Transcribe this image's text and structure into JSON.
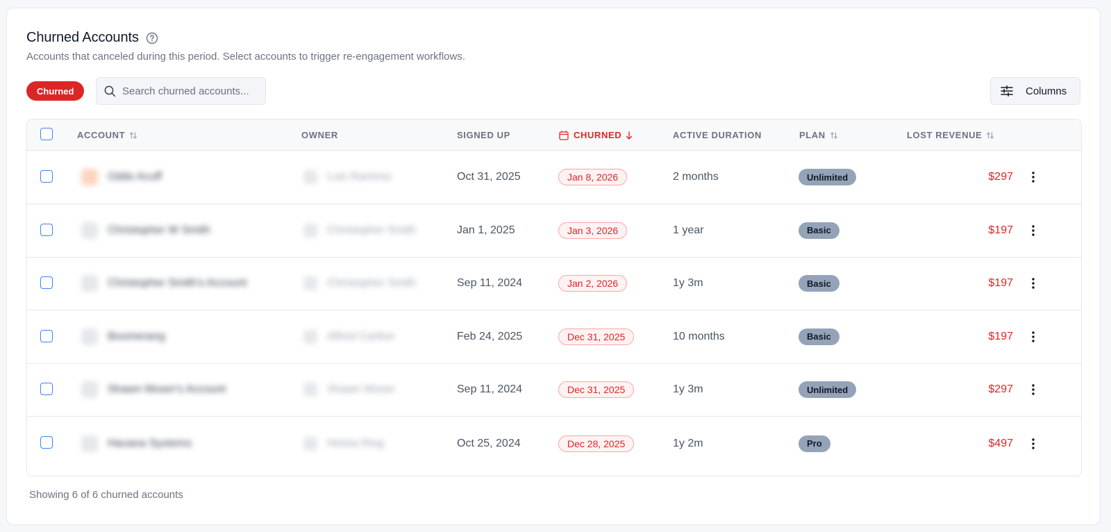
{
  "header": {
    "title": "Churned Accounts",
    "subtitle": "Accounts that canceled during this period. Select accounts to trigger re-engagement workflows."
  },
  "toolbar": {
    "filter_chip": "Churned",
    "search_placeholder": "Search churned accounts...",
    "columns_label": "Columns"
  },
  "table": {
    "columns": [
      "ACCOUNT",
      "OWNER",
      "SIGNED UP",
      "CHURNED",
      "ACTIVE DURATION",
      "PLAN",
      "LOST REVENUE"
    ],
    "rows": [
      {
        "account": "Odds Acuff",
        "owner": "Luis Ramirez",
        "signed_up": "Oct 31, 2025",
        "churned": "Jan 8, 2026",
        "duration": "2 months",
        "plan": "Unlimited",
        "revenue": "$297"
      },
      {
        "account": "Christopher W Smith",
        "owner": "Christopher Smith",
        "signed_up": "Jan 1, 2025",
        "churned": "Jan 3, 2026",
        "duration": "1 year",
        "plan": "Basic",
        "revenue": "$197"
      },
      {
        "account": "Christopher Smith's Account",
        "owner": "Christopher Smith",
        "signed_up": "Sep 11, 2024",
        "churned": "Jan 2, 2026",
        "duration": "1y 3m",
        "plan": "Basic",
        "revenue": "$197"
      },
      {
        "account": "Boomerang",
        "owner": "Alfred Carlton",
        "signed_up": "Feb 24, 2025",
        "churned": "Dec 31, 2025",
        "duration": "10 months",
        "plan": "Basic",
        "revenue": "$197"
      },
      {
        "account": "Shawn Moser's Account",
        "owner": "Shawn Moser",
        "signed_up": "Sep 11, 2024",
        "churned": "Dec 31, 2025",
        "duration": "1y 3m",
        "plan": "Unlimited",
        "revenue": "$297"
      },
      {
        "account": "Havana Systems",
        "owner": "Helvia Ring",
        "signed_up": "Oct 25, 2024",
        "churned": "Dec 28, 2025",
        "duration": "1y 2m",
        "plan": "Pro",
        "revenue": "$497"
      }
    ]
  },
  "footer": {
    "summary": "Showing 6 of 6 churned accounts"
  },
  "colors": {
    "accent_red": "#dc2626",
    "checkbox_blue": "#3b82f6",
    "badge_gray": "#94a3b8"
  }
}
